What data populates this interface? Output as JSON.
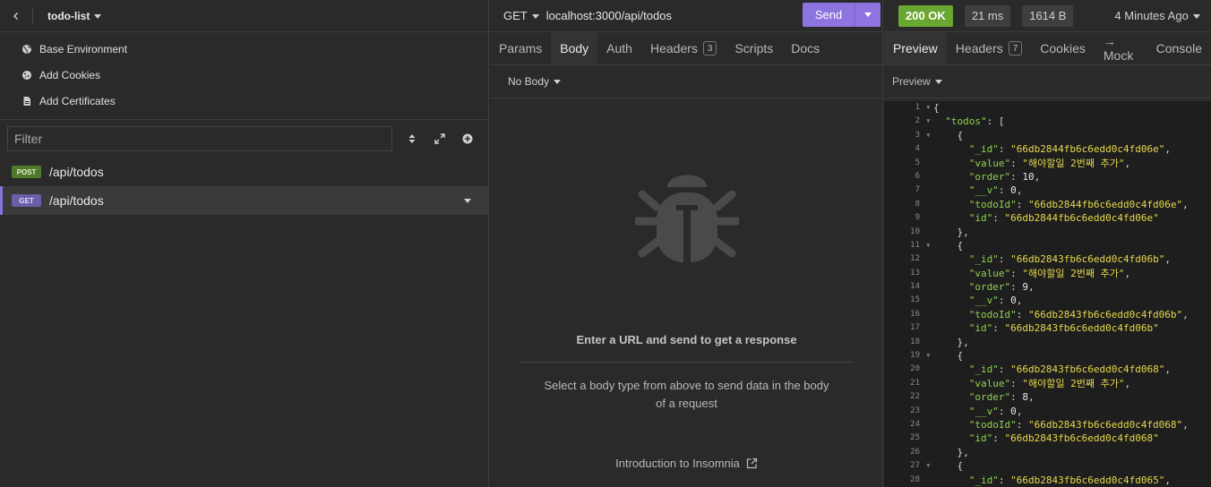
{
  "sidebar": {
    "project_name": "todo-list",
    "links": [
      {
        "label": "Base Environment",
        "icon": "globe-icon"
      },
      {
        "label": "Add Cookies",
        "icon": "cookie-icon"
      },
      {
        "label": "Add Certificates",
        "icon": "certificate-icon"
      }
    ],
    "filter_placeholder": "Filter",
    "requests": [
      {
        "method": "POST",
        "path": "/api/todos",
        "active": false
      },
      {
        "method": "GET",
        "path": "/api/todos",
        "active": true
      }
    ]
  },
  "request": {
    "method": "GET",
    "url": "localhost:3000/api/todos",
    "send_label": "Send",
    "tabs": [
      {
        "label": "Params"
      },
      {
        "label": "Body",
        "active": true
      },
      {
        "label": "Auth"
      },
      {
        "label": "Headers",
        "count": "3"
      },
      {
        "label": "Scripts"
      },
      {
        "label": "Docs"
      }
    ],
    "body_type": "No Body",
    "empty_title": "Enter a URL and send to get a response",
    "empty_desc": "Select a body type from above to send data in the body of a request",
    "intro_link": "Introduction to Insomnia"
  },
  "response": {
    "status": "200 OK",
    "time": "21 ms",
    "size": "1614 B",
    "time_ago": "4 Minutes Ago",
    "tabs": [
      {
        "label": "Preview",
        "active": true
      },
      {
        "label": "Headers",
        "count": "7"
      },
      {
        "label": "Cookies"
      },
      {
        "label": "→ Mock"
      },
      {
        "label": "Console"
      }
    ],
    "preview_mode": "Preview",
    "lines": [
      {
        "n": "1",
        "fold": true,
        "indent": 0,
        "t": "{"
      },
      {
        "n": "2",
        "fold": true,
        "indent": 1,
        "k": "todos",
        "t": ": ["
      },
      {
        "n": "3",
        "fold": true,
        "indent": 2,
        "t": "{"
      },
      {
        "n": "4",
        "indent": 3,
        "k": "_id",
        "s": "66db2844fb6c6edd0c4fd06e",
        "t": ","
      },
      {
        "n": "5",
        "indent": 3,
        "k": "value",
        "s": "해야할일 2번째 추가",
        "t": ","
      },
      {
        "n": "6",
        "indent": 3,
        "k": "order",
        "v": "10",
        "t": ","
      },
      {
        "n": "7",
        "indent": 3,
        "k": "__v",
        "v": "0",
        "t": ","
      },
      {
        "n": "8",
        "indent": 3,
        "k": "todoId",
        "s": "66db2844fb6c6edd0c4fd06e",
        "t": ","
      },
      {
        "n": "9",
        "indent": 3,
        "k": "id",
        "s": "66db2844fb6c6edd0c4fd06e",
        "t": ""
      },
      {
        "n": "10",
        "indent": 2,
        "t": "},"
      },
      {
        "n": "11",
        "fold": true,
        "indent": 2,
        "t": "{"
      },
      {
        "n": "12",
        "indent": 3,
        "k": "_id",
        "s": "66db2843fb6c6edd0c4fd06b",
        "t": ","
      },
      {
        "n": "13",
        "indent": 3,
        "k": "value",
        "s": "해야할일 2번째 추가",
        "t": ","
      },
      {
        "n": "14",
        "indent": 3,
        "k": "order",
        "v": "9",
        "t": ","
      },
      {
        "n": "15",
        "indent": 3,
        "k": "__v",
        "v": "0",
        "t": ","
      },
      {
        "n": "16",
        "indent": 3,
        "k": "todoId",
        "s": "66db2843fb6c6edd0c4fd06b",
        "t": ","
      },
      {
        "n": "17",
        "indent": 3,
        "k": "id",
        "s": "66db2843fb6c6edd0c4fd06b",
        "t": ""
      },
      {
        "n": "18",
        "indent": 2,
        "t": "},"
      },
      {
        "n": "19",
        "fold": true,
        "indent": 2,
        "t": "{"
      },
      {
        "n": "20",
        "indent": 3,
        "k": "_id",
        "s": "66db2843fb6c6edd0c4fd068",
        "t": ","
      },
      {
        "n": "21",
        "indent": 3,
        "k": "value",
        "s": "해야할일 2번째 추가",
        "t": ","
      },
      {
        "n": "22",
        "indent": 3,
        "k": "order",
        "v": "8",
        "t": ","
      },
      {
        "n": "23",
        "indent": 3,
        "k": "__v",
        "v": "0",
        "t": ","
      },
      {
        "n": "24",
        "indent": 3,
        "k": "todoId",
        "s": "66db2843fb6c6edd0c4fd068",
        "t": ","
      },
      {
        "n": "25",
        "indent": 3,
        "k": "id",
        "s": "66db2843fb6c6edd0c4fd068",
        "t": ""
      },
      {
        "n": "26",
        "indent": 2,
        "t": "},"
      },
      {
        "n": "27",
        "fold": true,
        "indent": 2,
        "t": "{"
      },
      {
        "n": "28",
        "indent": 3,
        "k": "_id",
        "s": "66db2843fb6c6edd0c4fd065",
        "t": ","
      }
    ]
  },
  "colors": {
    "accent": "#8d74de",
    "status_ok": "#6aa632",
    "json_key": "#8fd14f",
    "json_string": "#e6d84b"
  }
}
